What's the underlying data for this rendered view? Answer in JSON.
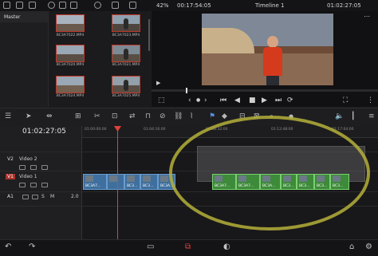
{
  "topbar": {
    "zoom": "42%",
    "source_timecode": "00:17:54:05",
    "timeline_name": "Timeline 1",
    "record_timecode": "01:02:27:05"
  },
  "media_pool": {
    "bin": "Master",
    "clips": [
      {
        "name": "BC3A7020.MP4"
      },
      {
        "name": "BC3A7021.MP4"
      },
      {
        "name": "BC3A7022.MP4"
      },
      {
        "name": "BC3A7023.MP4"
      },
      {
        "name": "BC3A7024.MP4"
      },
      {
        "name": "BC3A7025.MP4"
      }
    ]
  },
  "timeline": {
    "timecode": "01:02:27:05",
    "ruler": [
      "01:00:00:00",
      "01:04:16:00",
      "01:08:32:00",
      "01:12:48:00",
      "01:17:04:00"
    ],
    "tracks": {
      "v2": {
        "tag": "V2",
        "name": "Video 2"
      },
      "v1": {
        "tag": "V1",
        "name": "Video 1"
      },
      "a1": {
        "tag": "A1",
        "gain": "2.0",
        "solo": "S",
        "mute": "M"
      }
    },
    "blue_clips": [
      "BC3A7...",
      "BC3...",
      "BC3...",
      "BC3A..."
    ],
    "green_clips": [
      "BC3A7...",
      "BC3A7...",
      "BC3A...",
      "BC3...",
      "BC3...",
      "BC3...",
      "BC3..."
    ]
  },
  "colors": {
    "accent_red": "#e0413a",
    "clip_blue": "#3e6f9e",
    "clip_green": "#3d8a3a",
    "annotation": "#b5b03a"
  },
  "icons": [
    "folder-icon",
    "sliders-icon",
    "brush-icon",
    "scissors-icon",
    "link-icon",
    "flag-icon",
    "play-icon",
    "stop-icon",
    "home-icon",
    "gear-icon"
  ]
}
